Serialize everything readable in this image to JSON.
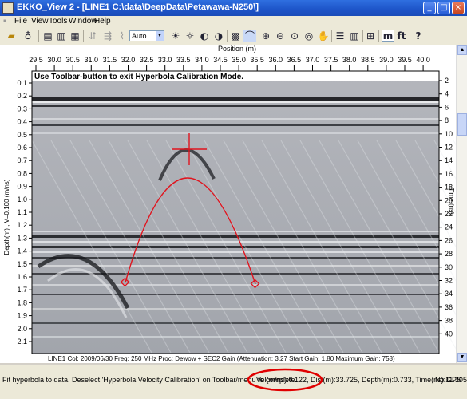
{
  "window": {
    "title": "EKKO_View 2 - [LINE1 C:\\data\\DeepData\\Petawawa-N250\\]",
    "controls": {
      "minimize": "_",
      "maximize": "□",
      "close": "×"
    }
  },
  "menu": [
    "File",
    "View",
    "Tools",
    "Window",
    "Help"
  ],
  "toolbar": {
    "gain_select": "Auto",
    "unit_m": "m",
    "unit_ft": "ft"
  },
  "plot": {
    "x_axis_title": "Position (m)",
    "x_ticks": [
      "29.5",
      "30.0",
      "30.5",
      "31.0",
      "31.5",
      "32.0",
      "32.5",
      "33.0",
      "33.5",
      "34.0",
      "34.5",
      "35.0",
      "35.5",
      "36.0",
      "36.5",
      "37.0",
      "37.5",
      "38.0",
      "38.5",
      "39.0",
      "39.5",
      "40.0"
    ],
    "left_axis_title": "Depth(m) , V=0.100 (m/ns)",
    "depth_ticks": [
      "0.1",
      "0.2",
      "0.3",
      "0.4",
      "0.5",
      "0.6",
      "0.7",
      "0.8",
      "0.9",
      "1.0",
      "1.1",
      "1.2",
      "1.3",
      "1.4",
      "1.5",
      "1.6",
      "1.7",
      "1.8",
      "1.9",
      "2.0",
      "2.1"
    ],
    "right_axis_title": "Time (ns)",
    "time_ticks": [
      "2",
      "4",
      "6",
      "8",
      "10",
      "12",
      "14",
      "16",
      "18",
      "20",
      "22",
      "24",
      "26",
      "28",
      "30",
      "32",
      "34",
      "36",
      "38",
      "40"
    ],
    "hint": "Use Toolbar-button to exit Hyperbola Calibration Mode.",
    "info_line": "LINE1  Col: 2009/06/30 Freq: 250 MHz Proc: Dewow + SEC2 Gain (Attenuation: 3.27 Start Gain: 1.80 Maximum Gain: 758)"
  },
  "status": {
    "message": "Fit hyperbola to data. Deselect 'Hyperbola Velocity Calibration' on Toolbar/menu to complete.",
    "readout": "Vel(m/ns):0.122, Dist(m):33.725, Depth(m):0.733, Time(ns):11.305",
    "gps": "No GPS"
  },
  "colors": {
    "hyperbola": "#e0141e",
    "titlebar": "#1d54c8",
    "highlight_ellipse": "#e00000"
  }
}
